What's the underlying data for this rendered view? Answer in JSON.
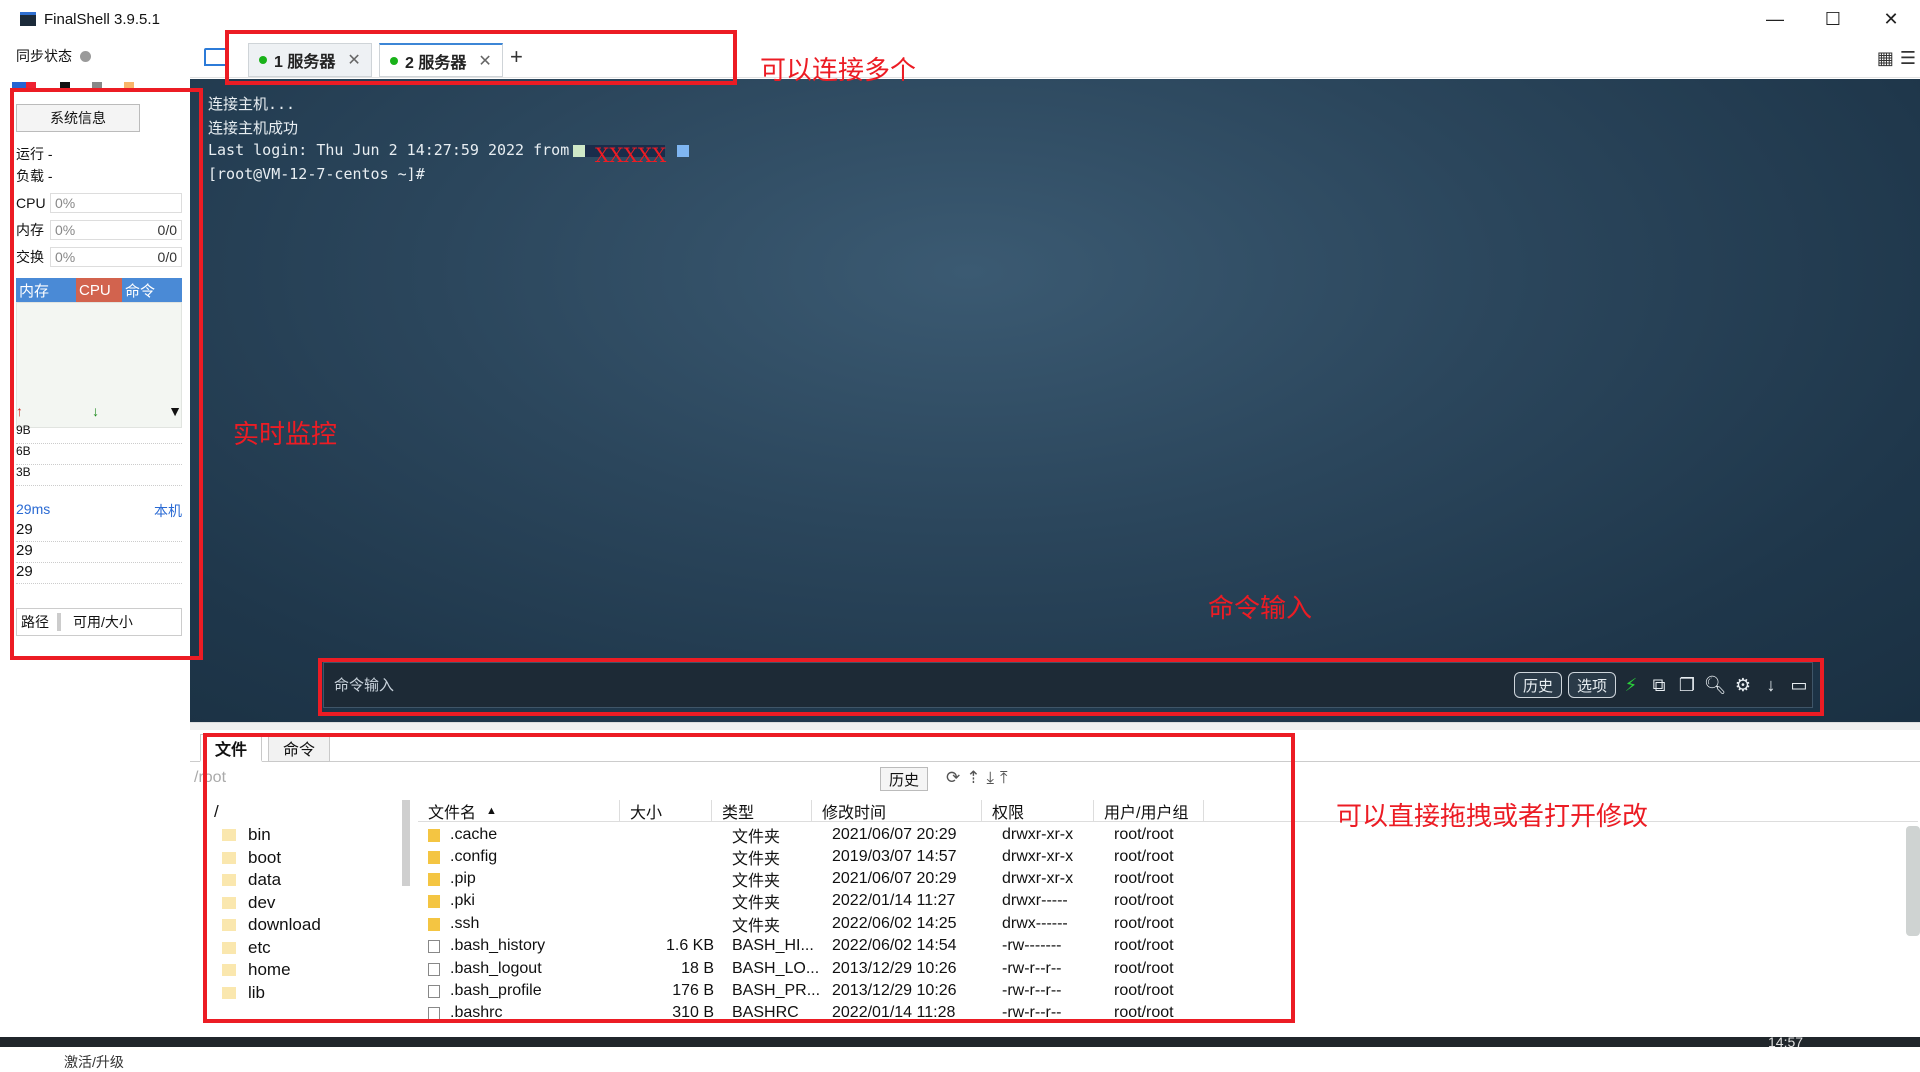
{
  "window": {
    "title": "FinalShell 3.9.5.1"
  },
  "sidebar": {
    "sync_label": "同步状态",
    "sysinfo_button": "系统信息",
    "run_label": "运行 -",
    "load_label": "负载 -",
    "cpu": {
      "label": "CPU",
      "value": "0%"
    },
    "mem": {
      "label": "内存",
      "value": "0%",
      "extra": "0/0"
    },
    "swap": {
      "label": "交换",
      "value": "0%",
      "extra": "0/0"
    },
    "proc_headers": [
      "内存",
      "CPU",
      "命令"
    ],
    "net_ticks": [
      "9B",
      "6B",
      "3B"
    ],
    "ping": {
      "ms": "29ms",
      "host": "本机",
      "values": [
        "29",
        "29",
        "29"
      ]
    },
    "disk_headers": [
      "路径",
      "可用/大小"
    ],
    "activate": "激活/升级"
  },
  "tabs": [
    {
      "label": "1 服务器",
      "active": false
    },
    {
      "label": "2 服务器",
      "active": true
    }
  ],
  "terminal": {
    "lines": [
      "连接主机...",
      "连接主机成功",
      "Last login: Thu Jun  2 14:27:59 2022 from",
      "[root@VM-12-7-centos ~]#"
    ],
    "redacted_mark": "XXXXX"
  },
  "command_bar": {
    "placeholder": "命令输入",
    "history": "历史",
    "options": "选项"
  },
  "file_panel": {
    "tabs": [
      "文件",
      "命令"
    ],
    "path": "/root",
    "history": "历史",
    "tree_root": "/",
    "tree_items": [
      "bin",
      "boot",
      "data",
      "dev",
      "download",
      "etc",
      "home",
      "lib"
    ],
    "columns": [
      "文件名",
      "大小",
      "类型",
      "修改时间",
      "权限",
      "用户/用户组"
    ],
    "rows": [
      {
        "name": ".cache",
        "size": "",
        "type": "文件夹",
        "time": "2021/06/07 20:29",
        "perm": "drwxr-xr-x",
        "user": "root/root",
        "kind": "folder"
      },
      {
        "name": ".config",
        "size": "",
        "type": "文件夹",
        "time": "2019/03/07 14:57",
        "perm": "drwxr-xr-x",
        "user": "root/root",
        "kind": "folder"
      },
      {
        "name": ".pip",
        "size": "",
        "type": "文件夹",
        "time": "2021/06/07 20:29",
        "perm": "drwxr-xr-x",
        "user": "root/root",
        "kind": "folder"
      },
      {
        "name": ".pki",
        "size": "",
        "type": "文件夹",
        "time": "2022/01/14 11:27",
        "perm": "drwxr-----",
        "user": "root/root",
        "kind": "folder"
      },
      {
        "name": ".ssh",
        "size": "",
        "type": "文件夹",
        "time": "2022/06/02 14:25",
        "perm": "drwx------",
        "user": "root/root",
        "kind": "folder"
      },
      {
        "name": ".bash_history",
        "size": "1.6 KB",
        "type": "BASH_HI...",
        "time": "2022/06/02 14:54",
        "perm": "-rw-------",
        "user": "root/root",
        "kind": "file"
      },
      {
        "name": ".bash_logout",
        "size": "18 B",
        "type": "BASH_LO...",
        "time": "2013/12/29 10:26",
        "perm": "-rw-r--r--",
        "user": "root/root",
        "kind": "file"
      },
      {
        "name": ".bash_profile",
        "size": "176 B",
        "type": "BASH_PR...",
        "time": "2013/12/29 10:26",
        "perm": "-rw-r--r--",
        "user": "root/root",
        "kind": "file"
      },
      {
        "name": ".bashrc",
        "size": "310 B",
        "type": "BASHRC",
        "time": "2022/01/14 11:28",
        "perm": "-rw-r--r--",
        "user": "root/root",
        "kind": "file"
      }
    ]
  },
  "annotations": {
    "tabs_note": "可以连接多个",
    "monitor_note": "实时监控",
    "command_note": "命令输入",
    "files_note": "可以直接拖拽或者打开修改"
  },
  "taskbar": {
    "clock": "14:57"
  },
  "colors": {
    "annotation": "#ec1c24",
    "terminal_bg": "#2b465c",
    "status_dot": "#19b219"
  }
}
